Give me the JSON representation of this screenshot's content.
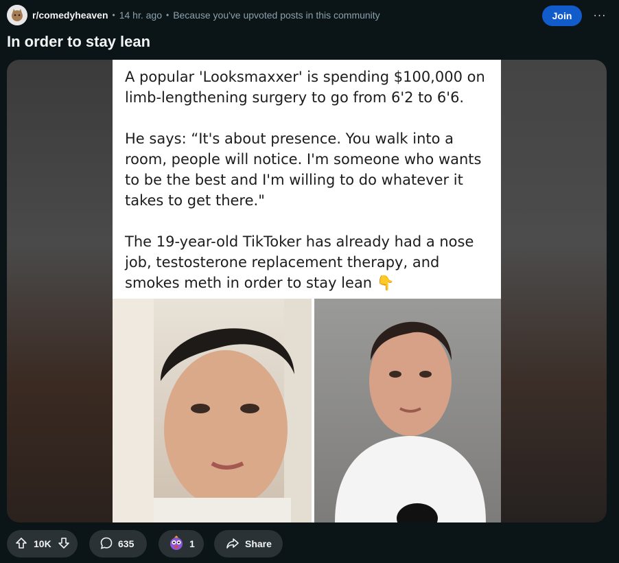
{
  "post": {
    "subreddit": "r/comedyheaven",
    "time": "14 hr. ago",
    "reason": "Because you've upvoted posts in this community",
    "join_label": "Join",
    "more_label": "···",
    "title": "In order to stay lean"
  },
  "image": {
    "paragraphs": [
      "A popular 'Looksmaxxer' is spending $100,000 on limb-lengthening surgery to go from 6'2 to 6'6.",
      "He says: “It's about presence. You walk into a room, people will notice. I'm someone who wants to be the best and I'm willing to do whatever it takes to get there.\"",
      "The 19-year-old TikToker has already had a nose job, testosterone replacement therapy, and smokes meth in order to stay lean"
    ],
    "emoji": "👇"
  },
  "actions": {
    "votes": "10K",
    "comments": "635",
    "awards": "1",
    "share_label": "Share"
  },
  "colors": {
    "background": "#0b1416",
    "join": "#115bca",
    "pill": "#2a3236",
    "muted": "#8ba2ad"
  },
  "icons": [
    "subreddit-avatar-icon",
    "more-options-icon",
    "upvote-icon",
    "downvote-icon",
    "comment-icon",
    "award-icon",
    "share-icon"
  ]
}
